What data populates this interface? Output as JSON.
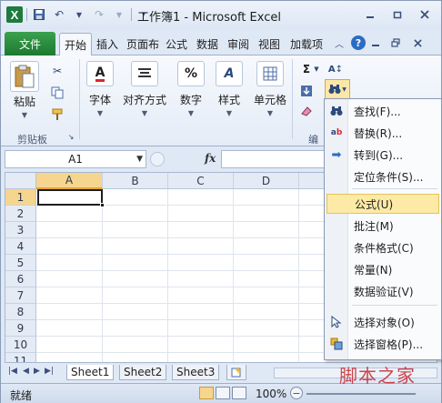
{
  "window": {
    "title": "工作簿1 - Microsoft Excel",
    "app_icon_letter": "X",
    "qat": {
      "save_icon": "save-icon",
      "undo_icon": "undo-icon",
      "redo_icon": "redo-icon",
      "customize_icon": "customize-qat-icon"
    },
    "controls": [
      "minimize",
      "restore",
      "close"
    ]
  },
  "tabs": {
    "file": "文件",
    "items": [
      "开始",
      "插入",
      "页面布",
      "公式",
      "数据",
      "审阅",
      "视图",
      "加载项"
    ],
    "active": "开始"
  },
  "ribbon": {
    "clipboard": {
      "paste": "粘贴",
      "group_label": "剪贴板"
    },
    "font": "字体",
    "alignment": "对齐方式",
    "number": "数字",
    "styles": "样式",
    "cells": "单元格",
    "editing_label": "编",
    "percent_glyph": "%",
    "sigma_glyph": "Σ"
  },
  "formula_bar": {
    "name_box": "A1",
    "fx": "fx",
    "formula": ""
  },
  "grid": {
    "columns": [
      "A",
      "B",
      "C",
      "D"
    ],
    "rows": [
      "1",
      "2",
      "3",
      "4",
      "5",
      "6",
      "7",
      "8",
      "9",
      "10",
      "11"
    ],
    "active_cell": "A1"
  },
  "sheets": {
    "tabs": [
      "Sheet1",
      "Sheet2",
      "Sheet3"
    ],
    "active": "Sheet1"
  },
  "status": {
    "ready": "就绪",
    "zoom": "100%"
  },
  "menu": {
    "items": [
      {
        "label": "查找(F)...",
        "icon": "binoculars-icon"
      },
      {
        "label": "替换(R)...",
        "icon": "replace-icon"
      },
      {
        "label": "转到(G)...",
        "icon": "goto-arrow-icon"
      },
      {
        "label": "定位条件(S)...",
        "icon": ""
      },
      {
        "label": "公式(U)",
        "icon": "",
        "highlighted": true
      },
      {
        "label": "批注(M)",
        "icon": ""
      },
      {
        "label": "条件格式(C)",
        "icon": ""
      },
      {
        "label": "常量(N)",
        "icon": ""
      },
      {
        "label": "数据验证(V)",
        "icon": ""
      },
      {
        "label": "选择对象(O)",
        "icon": "select-objects-icon"
      },
      {
        "label": "选择窗格(P)...",
        "icon": "selection-pane-icon"
      }
    ]
  },
  "watermark": "脚本之家"
}
